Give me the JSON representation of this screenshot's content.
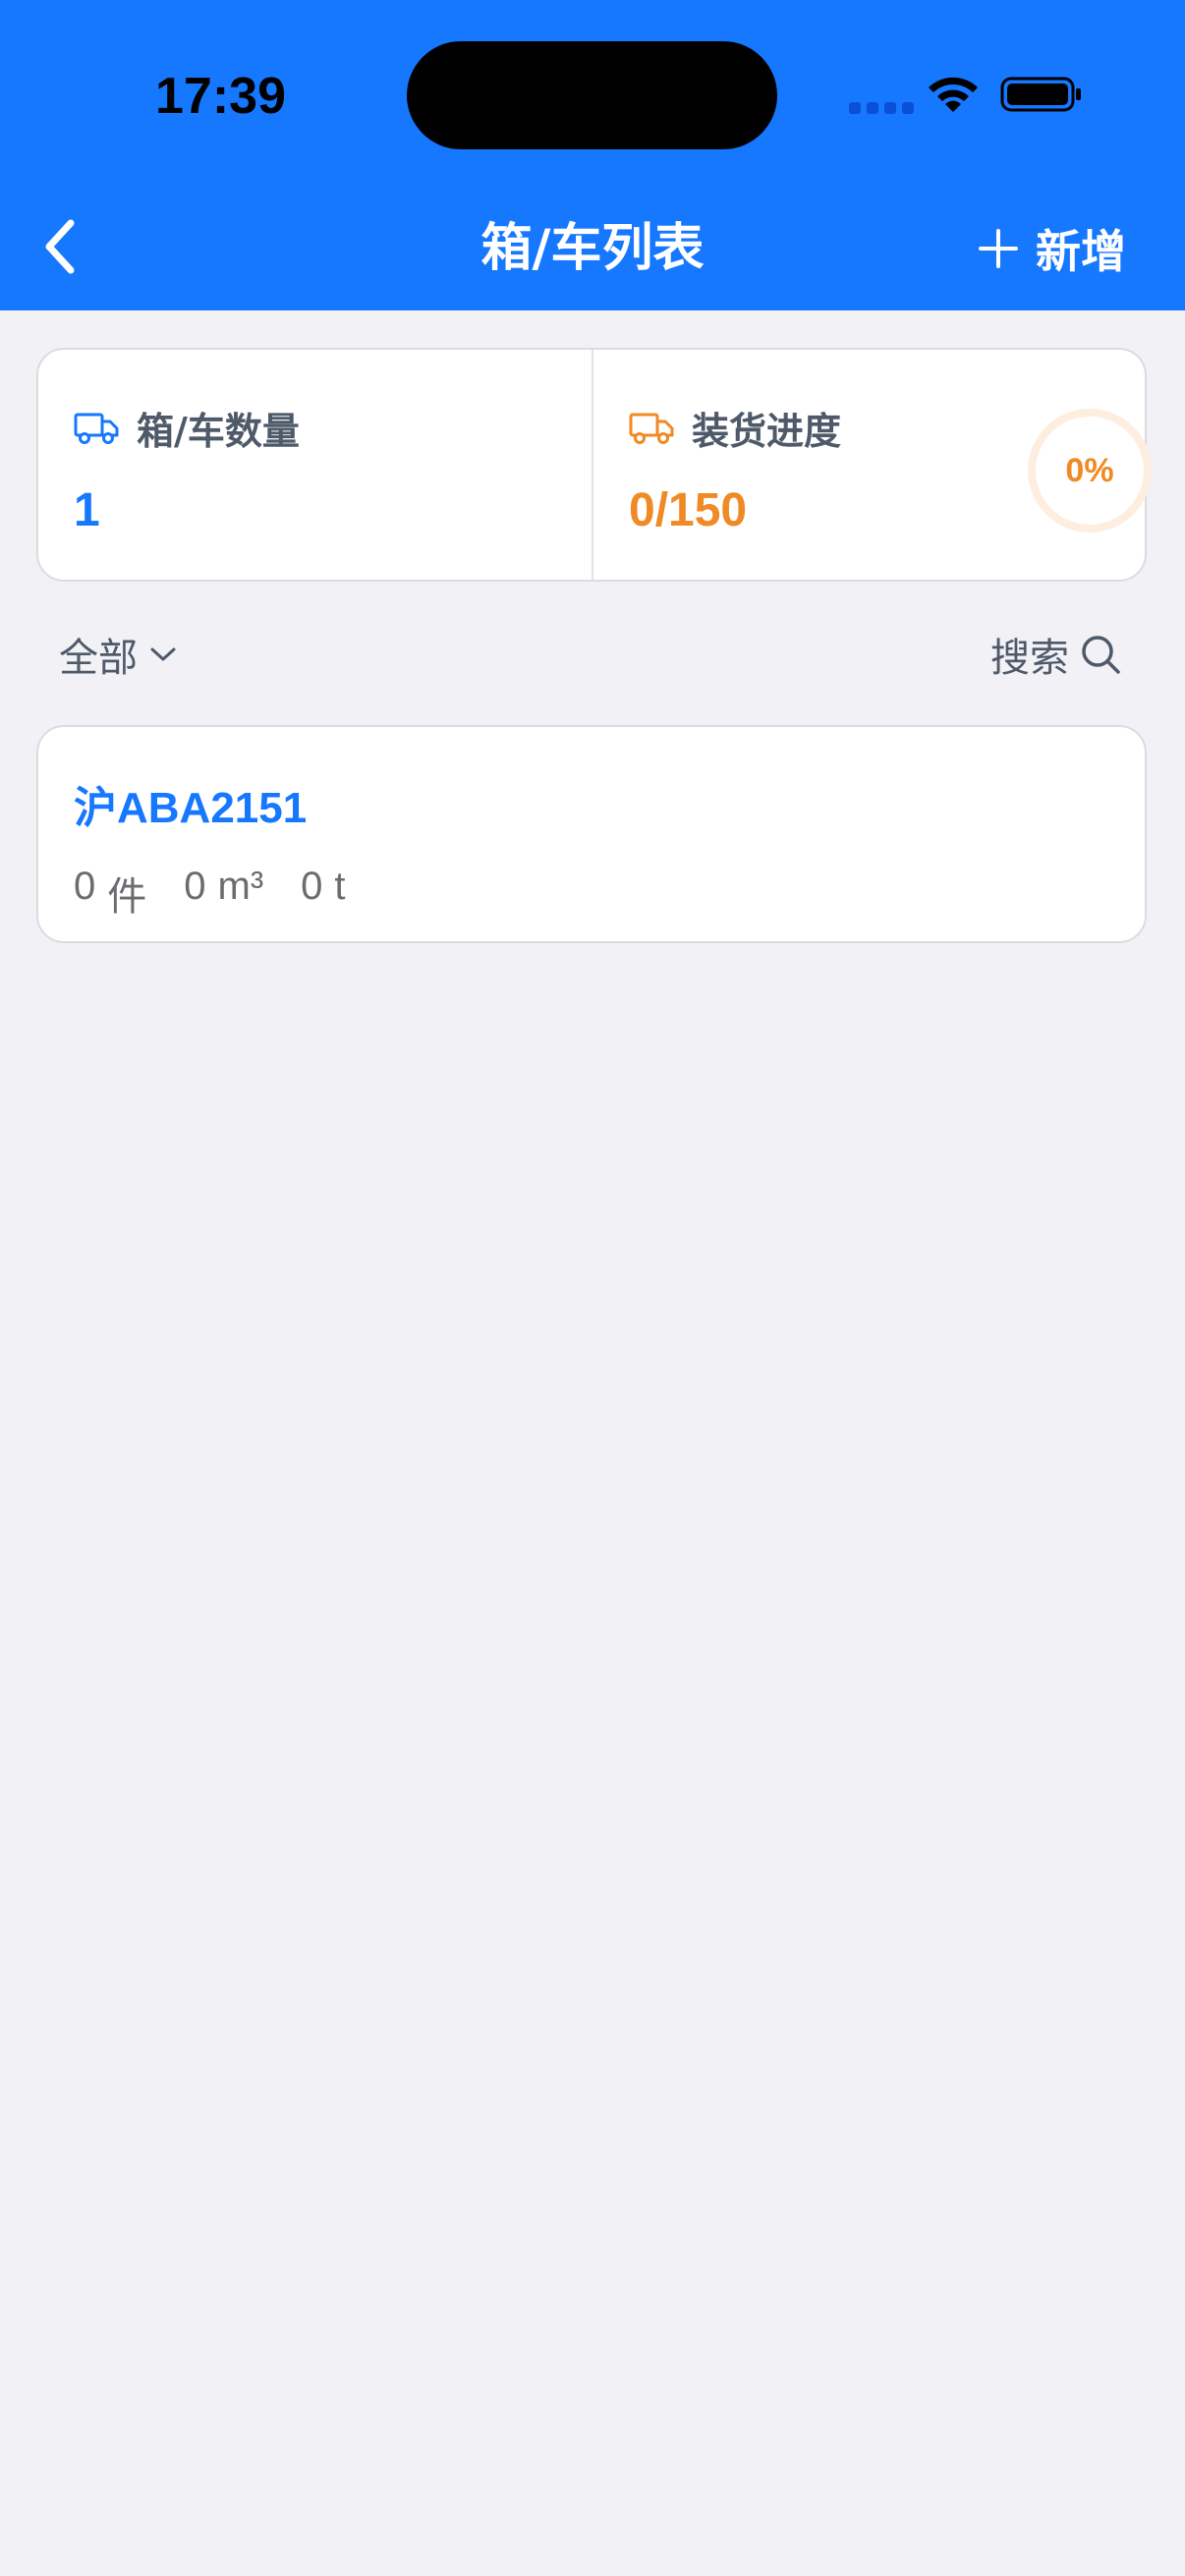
{
  "status_bar": {
    "time": "17:39"
  },
  "nav": {
    "title": "箱/车列表",
    "add_label": "新增",
    "back_icon": "chevron-left-icon",
    "add_icon": "plus-icon"
  },
  "stats": {
    "count_label": "箱/车数量",
    "count_value": "1",
    "progress_label": "装货进度",
    "progress_value": "0/150",
    "progress_percent_text": "0%",
    "progress_fraction": 0,
    "count_icon": "truck-icon",
    "progress_icon": "truck-icon"
  },
  "filter": {
    "selected": "全部",
    "search_label": "搜索"
  },
  "list": {
    "items": [
      {
        "plate": "沪ABA2151",
        "pieces_value": "0",
        "pieces_unit": "件",
        "volume_value": "0",
        "volume_unit": "m³",
        "weight_value": "0",
        "weight_unit": "t"
      }
    ]
  },
  "colors": {
    "primary": "#1677ff",
    "accent": "#f08a24",
    "background": "#f1f1f6"
  }
}
